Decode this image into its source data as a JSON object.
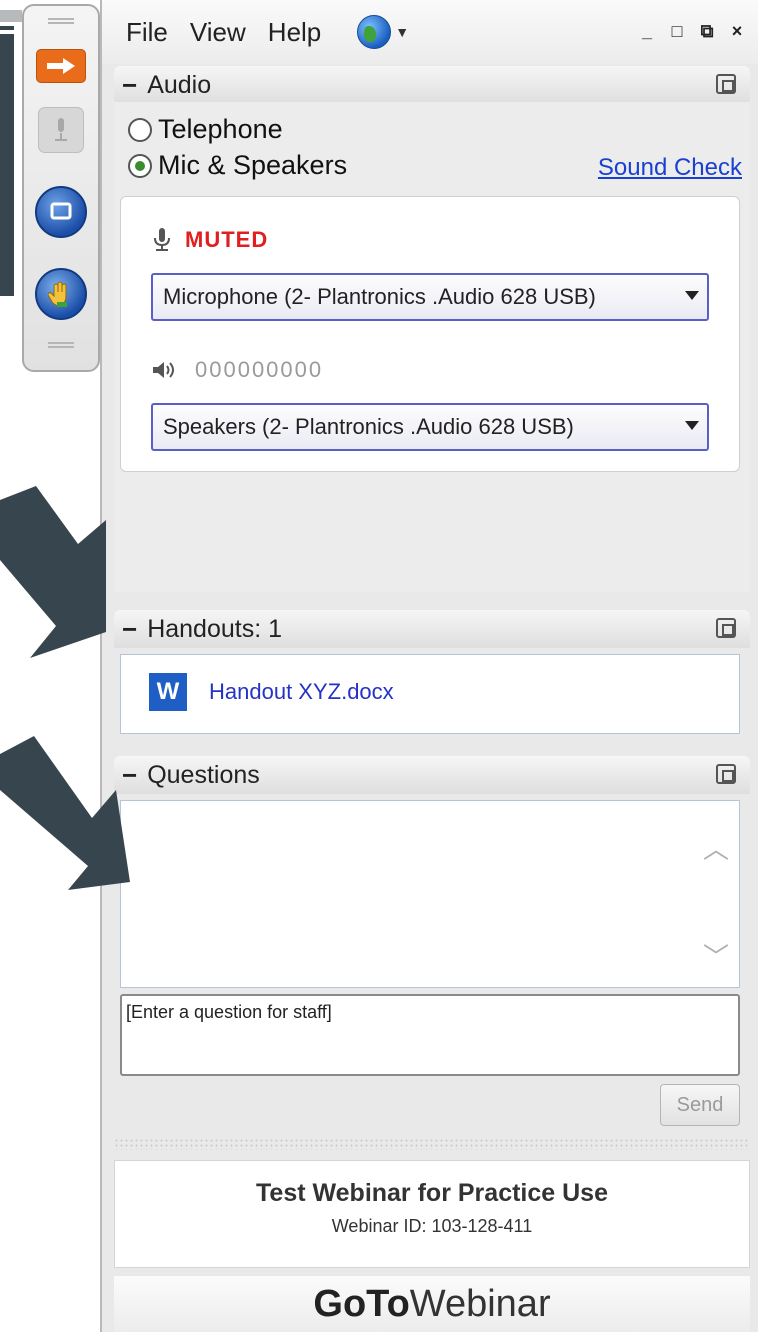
{
  "menu": {
    "file": "File",
    "view": "View",
    "help": "Help",
    "globe_icon": "globe-icon",
    "window_controls": [
      "_",
      "□",
      "⧉",
      "×"
    ]
  },
  "audio": {
    "header": "Audio",
    "telephone": "Telephone",
    "mic_speakers": "Mic & Speakers",
    "sound_check": "Sound Check",
    "mute_status": "MUTED",
    "microphone": "Microphone (2- Plantronics .Audio 628 USB)",
    "speaker_level": "000000000",
    "speakers": "Speakers (2- Plantronics .Audio 628 USB)"
  },
  "handouts": {
    "header": "Handouts: 1",
    "file": "Handout XYZ.docx",
    "file_icon_letter": "W"
  },
  "questions": {
    "header": "Questions",
    "placeholder": "[Enter a question for staff]",
    "send": "Send"
  },
  "footer": {
    "title": "Test Webinar for Practice Use",
    "webinar_id": "Webinar ID: 103-128-411",
    "brand_bold": "GoTo",
    "brand_light": "Webinar"
  },
  "colors": {
    "accent_orange": "#e96c1a",
    "link_blue": "#1a3fd3",
    "muted_red": "#e02020",
    "annotation_arrow": "#37464e"
  }
}
